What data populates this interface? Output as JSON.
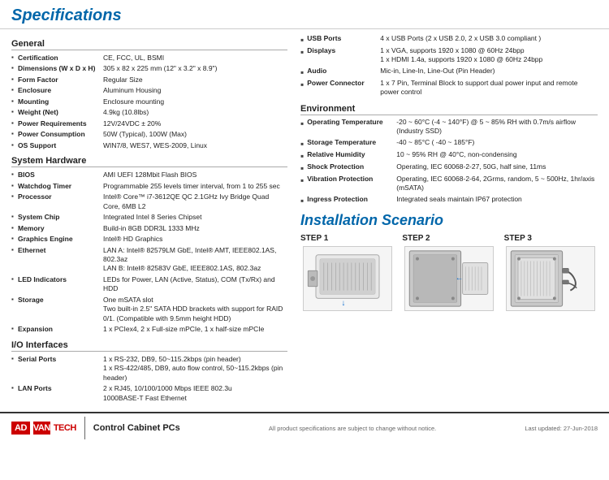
{
  "header": {
    "title": "Specifications"
  },
  "footer": {
    "logo_adv": "AD",
    "logo_vantech": "VANTECH",
    "product_category": "Control Cabinet PCs",
    "disclaimer": "All product specifications are subject to change without notice.",
    "last_updated": "Last updated: 27-Jun-2018"
  },
  "left": {
    "general_title": "General",
    "general_specs": [
      {
        "label": "Certification",
        "value": "CE, FCC, UL, BSMI"
      },
      {
        "label": "Dimensions (W x D x H)",
        "value": "305 x 82 x 225 mm (12\" x 3.2\" x 8.9\")"
      },
      {
        "label": "Form Factor",
        "value": "Regular Size"
      },
      {
        "label": "Enclosure",
        "value": "Aluminum Housing"
      },
      {
        "label": "Mounting",
        "value": "Enclosure mounting"
      },
      {
        "label": "Weight (Net)",
        "value": "4.9kg (10.8lbs)"
      },
      {
        "label": "Power Requirements",
        "value": "12V/24VDC ± 20%"
      },
      {
        "label": "Power Consumption",
        "value": "50W (Typical), 100W (Max)"
      },
      {
        "label": "OS Support",
        "value": "WIN7/8, WES7, WES-2009, Linux"
      }
    ],
    "system_hardware_title": "System Hardware",
    "system_hardware_specs": [
      {
        "label": "BIOS",
        "value": "AMI UEFI 128Mbit Flash BIOS"
      },
      {
        "label": "Watchdog Timer",
        "value": "Programmable 255 levels timer interval, from 1 to 255 sec"
      },
      {
        "label": "Processor",
        "value": "Intel® Core™ i7-3612QE QC 2.1GHz Ivy Bridge Quad Core, 6MB L2"
      },
      {
        "label": "System Chip",
        "value": "Integrated Intel 8 Series Chipset"
      },
      {
        "label": "Memory",
        "value": "Build-in 8GB DDR3L 1333 MHz"
      },
      {
        "label": "Graphics Engine",
        "value": "Intel® HD Graphics"
      },
      {
        "label": "Ethernet",
        "value": "LAN A: Intel® 82579LM GbE, Intel® AMT, IEEE802.1AS, 802.3az\nLAN B: Intel® 82583V GbE, IEEE802.1AS, 802.3az"
      },
      {
        "label": "LED Indicators",
        "value": "LEDs for Power, LAN (Active, Status), COM (Tx/Rx) and HDD"
      },
      {
        "label": "Storage",
        "value": "One mSATA slot\nTwo built-in 2.5\" SATA HDD brackets with support for RAID 0/1. (Compatible with 9.5mm height HDD)"
      },
      {
        "label": "Expansion",
        "value": "1 x PCIex4, 2 x Full-size mPCIe, 1 x half-size mPCIe"
      }
    ],
    "io_title": "I/O Interfaces",
    "io_specs": [
      {
        "label": "Serial Ports",
        "value": "1 x RS-232, DB9, 50~115.2kbps (pin header)\n1 x RS-422/485, DB9, auto flow control, 50~115.2kbps (pin header)"
      },
      {
        "label": "LAN Ports",
        "value": "2 x RJ45, 10/100/1000 Mbps IEEE 802.3u\n1000BASE-T Fast Ethernet"
      }
    ]
  },
  "right": {
    "io_items": [
      {
        "label": "USB Ports",
        "value": "4 x USB Ports (2 x USB 2.0, 2 x USB 3.0 compliant )"
      },
      {
        "label": "Displays",
        "value": "1 x VGA, supports 1920 x 1080 @ 60Hz 24bpp\n1 x HDMI 1.4a, supports 1920 x 1080 @ 60Hz 24bpp"
      },
      {
        "label": "Audio",
        "value": "Mic-in, Line-In, Line-Out (Pin Header)"
      },
      {
        "label": "Power Connector",
        "value": "1 x 7 Pin, Terminal Block to support dual power input and remote power control"
      }
    ],
    "environment_title": "Environment",
    "environment_items": [
      {
        "label": "Operating Temperature",
        "value": "-20 ~ 60°C (-4 ~ 140°F) @ 5 ~ 85% RH with 0.7m/s airflow (Industry SSD)"
      },
      {
        "label": "Storage Temperature",
        "value": "-40 ~ 85°C ( -40 ~ 185°F)"
      },
      {
        "label": "Relative Humidity",
        "value": "10 ~ 95% RH @ 40°C, non-condensing"
      },
      {
        "label": "Shock Protection",
        "value": "Operating, IEC 60068-2-27, 50G, half sine, 11ms"
      },
      {
        "label": "Vibration Protection",
        "value": "Operating, IEC 60068-2-64, 2Grms, random, 5 ~ 500Hz, 1hr/axis (mSATA)"
      },
      {
        "label": "Ingress Protection",
        "value": "Integrated seals maintain IP67 protection"
      }
    ],
    "installation_title": "Installation Scenario",
    "steps": [
      {
        "label": "STEP 1"
      },
      {
        "label": "STEP 2"
      },
      {
        "label": "STEP 3"
      }
    ]
  }
}
